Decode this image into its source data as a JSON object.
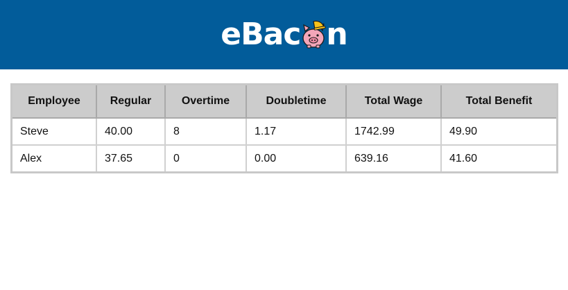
{
  "header": {
    "logo_text_left": "eBac",
    "logo_text_right": "n",
    "logo_icon": "piggy-bank-hardhat-icon",
    "brand_color": "#025c9a"
  },
  "table": {
    "headers": [
      "Employee",
      "Regular",
      "Overtime",
      "Doubletime",
      "Total Wage",
      "Total Benefit"
    ],
    "rows": [
      [
        "Steve",
        "40.00",
        "8",
        "1.17",
        "1742.99",
        "49.90"
      ],
      [
        "Alex",
        "37.65",
        "0",
        "0.00",
        "639.16",
        "41.60"
      ]
    ]
  }
}
